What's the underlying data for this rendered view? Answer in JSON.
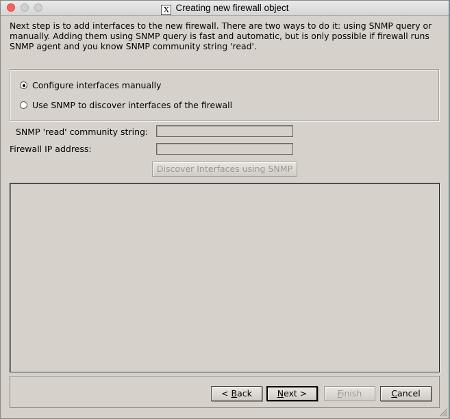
{
  "window": {
    "title": "Creating new firewall object",
    "title_icon": "x11-icon"
  },
  "intro_text": "Next step is to add interfaces to the new firewall. There are two ways to do it: using SNMP query or manually. Adding them using SNMP query is fast and automatic, but is only possible if firewall runs SNMP agent and you know SNMP community string 'read'.",
  "options": [
    {
      "label": "Configure interfaces manually",
      "checked": true
    },
    {
      "label": "Use SNMP to discover interfaces of the firewall",
      "checked": false
    }
  ],
  "form": {
    "community_label": "SNMP 'read' community string:",
    "community_value": "",
    "ip_label": "Firewall IP address:",
    "ip_value": ""
  },
  "discover_button": "Discover Interfaces using SNMP",
  "buttons": {
    "back": {
      "prefix": "< ",
      "mnemonic": "B",
      "rest": "ack"
    },
    "next": {
      "mnemonic": "N",
      "rest": "ext >"
    },
    "finish": {
      "mnemonic": "F",
      "rest": "inish"
    },
    "cancel": {
      "mnemonic": "C",
      "rest": "ancel"
    }
  }
}
